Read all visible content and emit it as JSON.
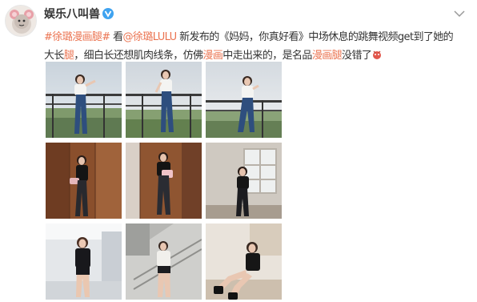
{
  "post": {
    "author": "娱乐八叫兽",
    "text": {
      "tag_open": "#徐璐",
      "tag_hl": "漫画腿",
      "tag_close": "#",
      "part1": " 看",
      "mention": "@徐璐LULU",
      "part2": " 新发布的《妈妈，你真好看》中场休息的跳舞视频get到了她的",
      "part3": "大长",
      "hl1": "腿",
      "part4": "，细白长还想肌肉线条，仿佛",
      "hl2": "漫画",
      "part5": "中走出来的，是名品",
      "hl3": "漫画腿",
      "part6": "没错了"
    },
    "photos": [
      {
        "name": "photo-1",
        "scene": "balcony"
      },
      {
        "name": "photo-2",
        "scene": "balcony"
      },
      {
        "name": "photo-3",
        "scene": "balcony"
      },
      {
        "name": "photo-4",
        "scene": "wood-wall"
      },
      {
        "name": "photo-5",
        "scene": "wood-wall"
      },
      {
        "name": "photo-6",
        "scene": "window-room"
      },
      {
        "name": "photo-7",
        "scene": "bright-hall"
      },
      {
        "name": "photo-8",
        "scene": "stairs"
      },
      {
        "name": "photo-9",
        "scene": "seated-floor"
      }
    ],
    "colors": {
      "accent": "#eb7350",
      "verified": "#3fa3f0",
      "text": "#333333"
    },
    "icons": [
      "avatar",
      "verified-icon",
      "chevron-down-icon",
      "emoji-icon"
    ]
  }
}
